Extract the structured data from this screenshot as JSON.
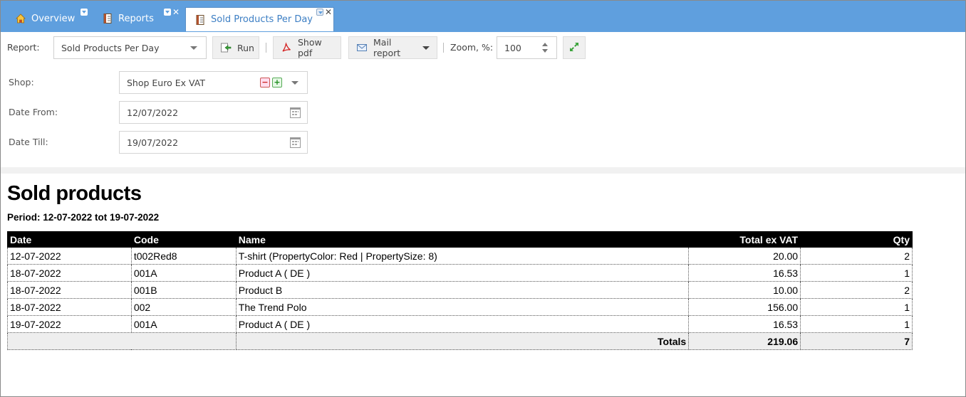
{
  "tabs": [
    {
      "label": "Overview",
      "icon": "home-icon"
    },
    {
      "label": "Reports",
      "icon": "report-icon"
    },
    {
      "label": "Sold Products Per Day",
      "icon": "report-icon",
      "active": true
    }
  ],
  "toolbar": {
    "report_label": "Report:",
    "report_value": "Sold Products Per Day",
    "run_label": "Run",
    "pdf_label": "Show pdf",
    "mail_label": "Mail report",
    "zoom_label": "Zoom, %:",
    "zoom_value": "100"
  },
  "form": {
    "shop_label": "Shop:",
    "shop_value": "Shop Euro Ex VAT",
    "date_from_label": "Date From:",
    "date_from_value": "12/07/2022",
    "date_till_label": "Date Till:",
    "date_till_value": "19/07/2022"
  },
  "report": {
    "title": "Sold products",
    "period": "Period: 12-07-2022 tot 19-07-2022",
    "columns": [
      "Date",
      "Code",
      "Name",
      "Total ex VAT",
      "Qty"
    ],
    "rows": [
      [
        "12-07-2022",
        "t002Red8",
        "T-shirt (PropertyColor: Red | PropertySize: 8)",
        "20.00",
        "2"
      ],
      [
        "18-07-2022",
        "001A",
        "Product A ( DE )",
        "16.53",
        "1"
      ],
      [
        "18-07-2022",
        "001B",
        "Product B",
        "10.00",
        "2"
      ],
      [
        "18-07-2022",
        "002",
        "The Trend Polo",
        "156.00",
        "1"
      ],
      [
        "19-07-2022",
        "001A",
        "Product A ( DE )",
        "16.53",
        "1"
      ]
    ],
    "totals_label": "Totals",
    "totals_value": "219.06",
    "totals_qty": "7"
  },
  "colors": {
    "tabbar": "#5f9fde",
    "active_tab_text": "#3d7fc4",
    "table_header": "#000000"
  }
}
